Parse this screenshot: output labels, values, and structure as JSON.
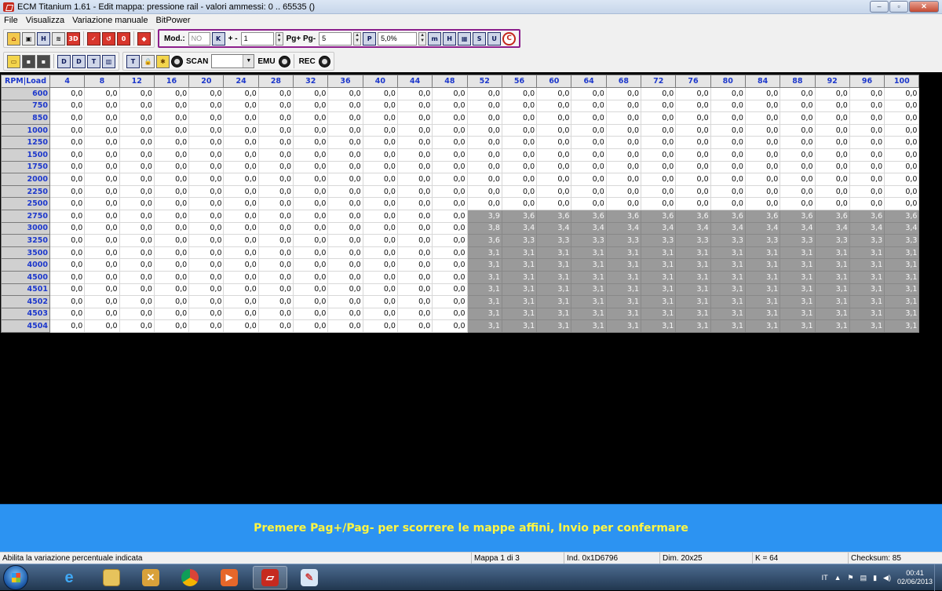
{
  "window": {
    "title": "ECM Titanium 1.61 - Edit mappa: pressione rail - valori ammessi: 0 .. 65535 ()",
    "controls": [
      "–",
      "▫",
      "✕"
    ]
  },
  "menu": [
    "File",
    "Visualizza",
    "Variazione manuale",
    "BitPower"
  ],
  "toolbar1": {
    "mod_label": "Mod.:",
    "mod_value": "NO",
    "k_label": "K",
    "plusminus_label": "+ -",
    "step_value": "1",
    "pg_label": "Pg+ Pg-",
    "pg_value": "5",
    "p_label": "P",
    "percent_value": "5,0%"
  },
  "toolbar2": {
    "scan_label": "SCAN",
    "scan_value": "",
    "emu_label": "EMU",
    "rec_label": "REC"
  },
  "grid": {
    "corner": "RPM|Load",
    "columns": [
      "4",
      "8",
      "12",
      "16",
      "20",
      "24",
      "28",
      "32",
      "36",
      "40",
      "44",
      "48",
      "52",
      "56",
      "60",
      "64",
      "68",
      "72",
      "76",
      "80",
      "84",
      "88",
      "92",
      "96",
      "100"
    ],
    "rows": [
      {
        "rpm": "600",
        "values": [
          "0,0",
          "0,0",
          "0,0",
          "0,0",
          "0,0",
          "0,0",
          "0,0",
          "0,0",
          "0,0",
          "0,0",
          "0,0",
          "0,0",
          "0,0",
          "0,0",
          "0,0",
          "0,0",
          "0,0",
          "0,0",
          "0,0",
          "0,0",
          "0,0",
          "0,0",
          "0,0",
          "0,0",
          "0,0"
        ]
      },
      {
        "rpm": "750",
        "values": [
          "0,0",
          "0,0",
          "0,0",
          "0,0",
          "0,0",
          "0,0",
          "0,0",
          "0,0",
          "0,0",
          "0,0",
          "0,0",
          "0,0",
          "0,0",
          "0,0",
          "0,0",
          "0,0",
          "0,0",
          "0,0",
          "0,0",
          "0,0",
          "0,0",
          "0,0",
          "0,0",
          "0,0",
          "0,0"
        ]
      },
      {
        "rpm": "850",
        "values": [
          "0,0",
          "0,0",
          "0,0",
          "0,0",
          "0,0",
          "0,0",
          "0,0",
          "0,0",
          "0,0",
          "0,0",
          "0,0",
          "0,0",
          "0,0",
          "0,0",
          "0,0",
          "0,0",
          "0,0",
          "0,0",
          "0,0",
          "0,0",
          "0,0",
          "0,0",
          "0,0",
          "0,0",
          "0,0"
        ]
      },
      {
        "rpm": "1000",
        "values": [
          "0,0",
          "0,0",
          "0,0",
          "0,0",
          "0,0",
          "0,0",
          "0,0",
          "0,0",
          "0,0",
          "0,0",
          "0,0",
          "0,0",
          "0,0",
          "0,0",
          "0,0",
          "0,0",
          "0,0",
          "0,0",
          "0,0",
          "0,0",
          "0,0",
          "0,0",
          "0,0",
          "0,0",
          "0,0"
        ]
      },
      {
        "rpm": "1250",
        "values": [
          "0,0",
          "0,0",
          "0,0",
          "0,0",
          "0,0",
          "0,0",
          "0,0",
          "0,0",
          "0,0",
          "0,0",
          "0,0",
          "0,0",
          "0,0",
          "0,0",
          "0,0",
          "0,0",
          "0,0",
          "0,0",
          "0,0",
          "0,0",
          "0,0",
          "0,0",
          "0,0",
          "0,0",
          "0,0"
        ]
      },
      {
        "rpm": "1500",
        "values": [
          "0,0",
          "0,0",
          "0,0",
          "0,0",
          "0,0",
          "0,0",
          "0,0",
          "0,0",
          "0,0",
          "0,0",
          "0,0",
          "0,0",
          "0,0",
          "0,0",
          "0,0",
          "0,0",
          "0,0",
          "0,0",
          "0,0",
          "0,0",
          "0,0",
          "0,0",
          "0,0",
          "0,0",
          "0,0"
        ]
      },
      {
        "rpm": "1750",
        "values": [
          "0,0",
          "0,0",
          "0,0",
          "0,0",
          "0,0",
          "0,0",
          "0,0",
          "0,0",
          "0,0",
          "0,0",
          "0,0",
          "0,0",
          "0,0",
          "0,0",
          "0,0",
          "0,0",
          "0,0",
          "0,0",
          "0,0",
          "0,0",
          "0,0",
          "0,0",
          "0,0",
          "0,0",
          "0,0"
        ]
      },
      {
        "rpm": "2000",
        "values": [
          "0,0",
          "0,0",
          "0,0",
          "0,0",
          "0,0",
          "0,0",
          "0,0",
          "0,0",
          "0,0",
          "0,0",
          "0,0",
          "0,0",
          "0,0",
          "0,0",
          "0,0",
          "0,0",
          "0,0",
          "0,0",
          "0,0",
          "0,0",
          "0,0",
          "0,0",
          "0,0",
          "0,0",
          "0,0"
        ]
      },
      {
        "rpm": "2250",
        "values": [
          "0,0",
          "0,0",
          "0,0",
          "0,0",
          "0,0",
          "0,0",
          "0,0",
          "0,0",
          "0,0",
          "0,0",
          "0,0",
          "0,0",
          "0,0",
          "0,0",
          "0,0",
          "0,0",
          "0,0",
          "0,0",
          "0,0",
          "0,0",
          "0,0",
          "0,0",
          "0,0",
          "0,0",
          "0,0"
        ]
      },
      {
        "rpm": "2500",
        "values": [
          "0,0",
          "0,0",
          "0,0",
          "0,0",
          "0,0",
          "0,0",
          "0,0",
          "0,0",
          "0,0",
          "0,0",
          "0,0",
          "0,0",
          "0,0",
          "0,0",
          "0,0",
          "0,0",
          "0,0",
          "0,0",
          "0,0",
          "0,0",
          "0,0",
          "0,0",
          "0,0",
          "0,0",
          "0,0"
        ]
      },
      {
        "rpm": "2750",
        "values": [
          "0,0",
          "0,0",
          "0,0",
          "0,0",
          "0,0",
          "0,0",
          "0,0",
          "0,0",
          "0,0",
          "0,0",
          "0,0",
          "0,0",
          "3,9",
          "3,6",
          "3,6",
          "3,6",
          "3,6",
          "3,6",
          "3,6",
          "3,6",
          "3,6",
          "3,6",
          "3,6",
          "3,6",
          "3,6"
        ]
      },
      {
        "rpm": "3000",
        "values": [
          "0,0",
          "0,0",
          "0,0",
          "0,0",
          "0,0",
          "0,0",
          "0,0",
          "0,0",
          "0,0",
          "0,0",
          "0,0",
          "0,0",
          "3,8",
          "3,4",
          "3,4",
          "3,4",
          "3,4",
          "3,4",
          "3,4",
          "3,4",
          "3,4",
          "3,4",
          "3,4",
          "3,4",
          "3,4"
        ]
      },
      {
        "rpm": "3250",
        "values": [
          "0,0",
          "0,0",
          "0,0",
          "0,0",
          "0,0",
          "0,0",
          "0,0",
          "0,0",
          "0,0",
          "0,0",
          "0,0",
          "0,0",
          "3,6",
          "3,3",
          "3,3",
          "3,3",
          "3,3",
          "3,3",
          "3,3",
          "3,3",
          "3,3",
          "3,3",
          "3,3",
          "3,3",
          "3,3"
        ]
      },
      {
        "rpm": "3500",
        "values": [
          "0,0",
          "0,0",
          "0,0",
          "0,0",
          "0,0",
          "0,0",
          "0,0",
          "0,0",
          "0,0",
          "0,0",
          "0,0",
          "0,0",
          "3,1",
          "3,1",
          "3,1",
          "3,1",
          "3,1",
          "3,1",
          "3,1",
          "3,1",
          "3,1",
          "3,1",
          "3,1",
          "3,1",
          "3,1"
        ]
      },
      {
        "rpm": "4000",
        "values": [
          "0,0",
          "0,0",
          "0,0",
          "0,0",
          "0,0",
          "0,0",
          "0,0",
          "0,0",
          "0,0",
          "0,0",
          "0,0",
          "0,0",
          "3,1",
          "3,1",
          "3,1",
          "3,1",
          "3,1",
          "3,1",
          "3,1",
          "3,1",
          "3,1",
          "3,1",
          "3,1",
          "3,1",
          "3,1"
        ]
      },
      {
        "rpm": "4500",
        "values": [
          "0,0",
          "0,0",
          "0,0",
          "0,0",
          "0,0",
          "0,0",
          "0,0",
          "0,0",
          "0,0",
          "0,0",
          "0,0",
          "0,0",
          "3,1",
          "3,1",
          "3,1",
          "3,1",
          "3,1",
          "3,1",
          "3,1",
          "3,1",
          "3,1",
          "3,1",
          "3,1",
          "3,1",
          "3,1"
        ]
      },
      {
        "rpm": "4501",
        "values": [
          "0,0",
          "0,0",
          "0,0",
          "0,0",
          "0,0",
          "0,0",
          "0,0",
          "0,0",
          "0,0",
          "0,0",
          "0,0",
          "0,0",
          "3,1",
          "3,1",
          "3,1",
          "3,1",
          "3,1",
          "3,1",
          "3,1",
          "3,1",
          "3,1",
          "3,1",
          "3,1",
          "3,1",
          "3,1"
        ]
      },
      {
        "rpm": "4502",
        "values": [
          "0,0",
          "0,0",
          "0,0",
          "0,0",
          "0,0",
          "0,0",
          "0,0",
          "0,0",
          "0,0",
          "0,0",
          "0,0",
          "0,0",
          "3,1",
          "3,1",
          "3,1",
          "3,1",
          "3,1",
          "3,1",
          "3,1",
          "3,1",
          "3,1",
          "3,1",
          "3,1",
          "3,1",
          "3,1"
        ]
      },
      {
        "rpm": "4503",
        "values": [
          "0,0",
          "0,0",
          "0,0",
          "0,0",
          "0,0",
          "0,0",
          "0,0",
          "0,0",
          "0,0",
          "0,0",
          "0,0",
          "0,0",
          "3,1",
          "3,1",
          "3,1",
          "3,1",
          "3,1",
          "3,1",
          "3,1",
          "3,1",
          "3,1",
          "3,1",
          "3,1",
          "3,1",
          "3,1"
        ]
      },
      {
        "rpm": "4504",
        "values": [
          "0,0",
          "0,0",
          "0,0",
          "0,0",
          "0,0",
          "0,0",
          "0,0",
          "0,0",
          "0,0",
          "0,0",
          "0,0",
          "0,0",
          "3,1",
          "3,1",
          "3,1",
          "3,1",
          "3,1",
          "3,1",
          "3,1",
          "3,1",
          "3,1",
          "3,1",
          "3,1",
          "3,1",
          "3,1"
        ]
      }
    ]
  },
  "message": "Premere Pag+/Pag- per scorrere le mappe affini, Invio per confermare",
  "statusbar": {
    "hint": "Abilita la variazione percentuale indicata",
    "map": "Mappa 1 di 3",
    "index": "Ind. 0x1D6796",
    "dim": "Dim. 20x25",
    "k": "K = 64",
    "checksum": "Checksum: 85"
  },
  "taskbar": {
    "lang": "IT",
    "time": "00:41",
    "date": "02/06/2013"
  }
}
